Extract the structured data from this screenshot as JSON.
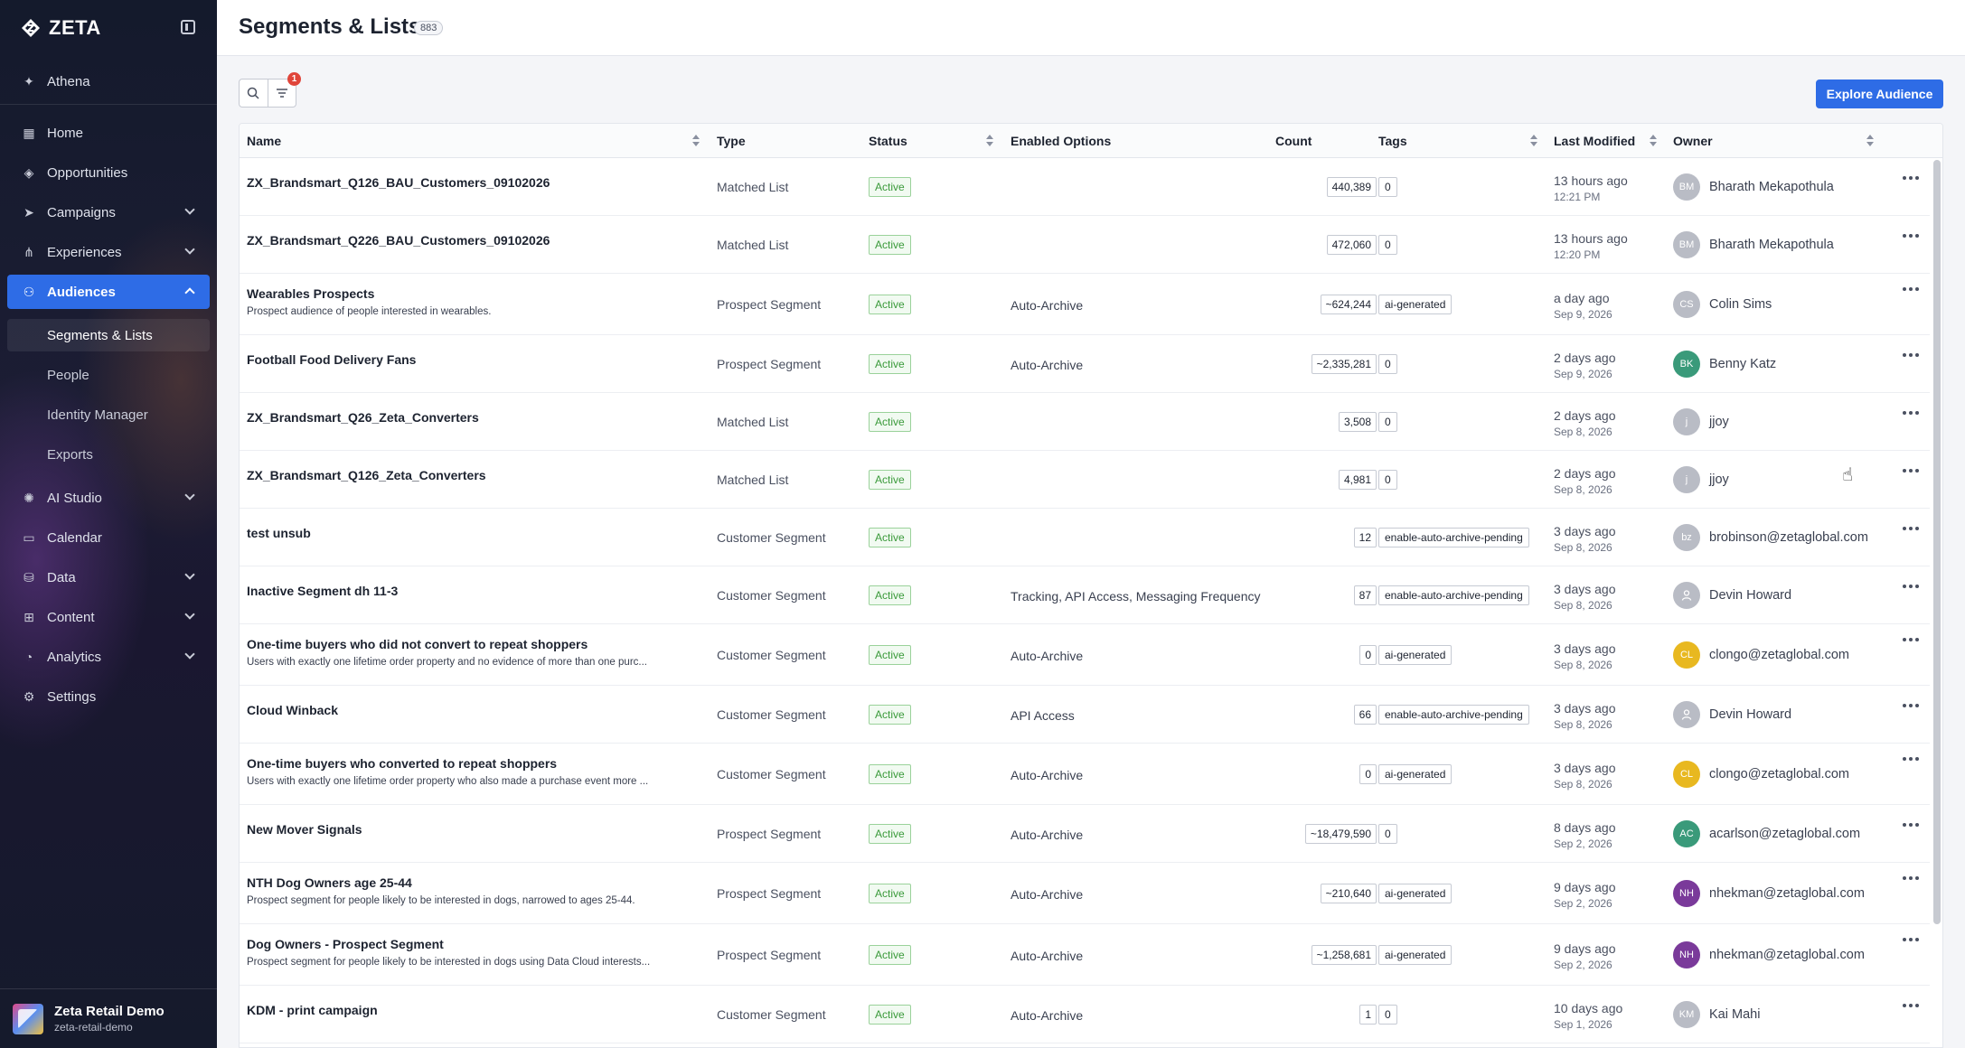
{
  "app": {
    "brand": "ZETA"
  },
  "sidebar": {
    "items": [
      {
        "label": "Athena",
        "icon": "sparkle-icon"
      },
      {
        "label": "Home",
        "icon": "grid-icon"
      },
      {
        "label": "Opportunities",
        "icon": "diamond-icon"
      },
      {
        "label": "Campaigns",
        "icon": "send-icon"
      },
      {
        "label": "Experiences",
        "icon": "hierarchy-icon"
      },
      {
        "label": "Audiences",
        "icon": "audience-icon"
      },
      {
        "label": "AI Studio",
        "icon": "brain-icon"
      },
      {
        "label": "Calendar",
        "icon": "calendar-icon"
      },
      {
        "label": "Data",
        "icon": "database-icon"
      },
      {
        "label": "Content",
        "icon": "content-icon"
      },
      {
        "label": "Analytics",
        "icon": "chart-icon"
      },
      {
        "label": "Settings",
        "icon": "gear-icon"
      }
    ],
    "sub_items": [
      "Segments & Lists",
      "People",
      "Identity Manager",
      "Exports"
    ],
    "account": {
      "name": "Zeta Retail Demo",
      "sub": "zeta-retail-demo"
    }
  },
  "header": {
    "title": "Segments & Lists",
    "count": "883"
  },
  "toolbar": {
    "filter_count": "1",
    "explore_label": "Explore Audience"
  },
  "table": {
    "columns": [
      "Name",
      "Type",
      "Status",
      "Enabled Options",
      "Count",
      "Tags",
      "Last Modified",
      "Owner"
    ],
    "rows": [
      {
        "name": "ZX_Brandsmart_Q126_BAU_Customers_09102026",
        "desc": "",
        "type": "Matched List",
        "status": "Active",
        "opts": "",
        "count": "440,389",
        "tag": "0",
        "mod": "13 hours ago",
        "date": "12:21 PM",
        "initials": "BM",
        "owner": "Bharath Mekapothula",
        "avatar_color": "#b9bcc5"
      },
      {
        "name": "ZX_Brandsmart_Q226_BAU_Customers_09102026",
        "desc": "",
        "type": "Matched List",
        "status": "Active",
        "opts": "",
        "count": "472,060",
        "tag": "0",
        "mod": "13 hours ago",
        "date": "12:20 PM",
        "initials": "BM",
        "owner": "Bharath Mekapothula",
        "avatar_color": "#b9bcc5"
      },
      {
        "name": "Wearables Prospects",
        "desc": "Prospect audience of people interested in wearables.",
        "type": "Prospect Segment",
        "status": "Active",
        "opts": "Auto-Archive",
        "count": "~624,244",
        "tag": "ai-generated",
        "mod": "a day ago",
        "date": "Sep 9, 2026",
        "initials": "CS",
        "owner": "Colin Sims",
        "avatar_color": "#b9bcc5"
      },
      {
        "name": "Football Food Delivery Fans",
        "desc": "",
        "type": "Prospect Segment",
        "status": "Active",
        "opts": "Auto-Archive",
        "count": "~2,335,281",
        "tag": "0",
        "mod": "2 days ago",
        "date": "Sep 9, 2026",
        "initials": "BK",
        "owner": "Benny Katz",
        "avatar_color": "#3a9a7a"
      },
      {
        "name": "ZX_Brandsmart_Q26_Zeta_Converters",
        "desc": "",
        "type": "Matched List",
        "status": "Active",
        "opts": "",
        "count": "3,508",
        "tag": "0",
        "mod": "2 days ago",
        "date": "Sep 8, 2026",
        "initials": "j",
        "owner": "jjoy",
        "avatar_color": "#b9bcc5"
      },
      {
        "name": "ZX_Brandsmart_Q126_Zeta_Converters",
        "desc": "",
        "type": "Matched List",
        "status": "Active",
        "opts": "",
        "count": "4,981",
        "tag": "0",
        "mod": "2 days ago",
        "date": "Sep 8, 2026",
        "initials": "j",
        "owner": "jjoy",
        "avatar_color": "#b9bcc5"
      },
      {
        "name": "test unsub",
        "desc": "",
        "type": "Customer Segment",
        "status": "Active",
        "opts": "",
        "count": "12",
        "tag": "enable-auto-archive-pending",
        "mod": "3 days ago",
        "date": "Sep 8, 2026",
        "initials": "bz",
        "owner": "brobinson@zetaglobal.com",
        "avatar_color": "#b9bcc5"
      },
      {
        "name": "Inactive Segment dh 11-3",
        "desc": "",
        "type": "Customer Segment",
        "status": "Active",
        "opts": "Tracking, API Access, Messaging Frequency",
        "count": "87",
        "tag": "enable-auto-archive-pending",
        "mod": "3 days ago",
        "date": "Sep 8, 2026",
        "initials": "",
        "owner": "Devin Howard",
        "avatar_color": "#b9bcc5"
      },
      {
        "name": "One-time buyers who did not convert to repeat shoppers",
        "desc": "Users with exactly one lifetime order property and no evidence of more than one purc...",
        "type": "Customer Segment",
        "status": "Active",
        "opts": "Auto-Archive",
        "count": "0",
        "tag": "ai-generated",
        "mod": "3 days ago",
        "date": "Sep 8, 2026",
        "initials": "CL",
        "owner": "clongo@zetaglobal.com",
        "avatar_color": "#e8b820"
      },
      {
        "name": "Cloud Winback",
        "desc": "",
        "type": "Customer Segment",
        "status": "Active",
        "opts": "API Access",
        "count": "66",
        "tag": "enable-auto-archive-pending",
        "mod": "3 days ago",
        "date": "Sep 8, 2026",
        "initials": "",
        "owner": "Devin Howard",
        "avatar_color": "#b9bcc5"
      },
      {
        "name": "One-time buyers who converted to repeat shoppers",
        "desc": "Users with exactly one lifetime order property who also made a purchase event more ...",
        "type": "Customer Segment",
        "status": "Active",
        "opts": "Auto-Archive",
        "count": "0",
        "tag": "ai-generated",
        "mod": "3 days ago",
        "date": "Sep 8, 2026",
        "initials": "CL",
        "owner": "clongo@zetaglobal.com",
        "avatar_color": "#e8b820"
      },
      {
        "name": "New Mover Signals",
        "desc": "",
        "type": "Prospect Segment",
        "status": "Active",
        "opts": "Auto-Archive",
        "count": "~18,479,590",
        "tag": "0",
        "mod": "8 days ago",
        "date": "Sep 2, 2026",
        "initials": "AC",
        "owner": "acarlson@zetaglobal.com",
        "avatar_color": "#3a9a7a"
      },
      {
        "name": "NTH Dog Owners age 25-44",
        "desc": "Prospect segment for people likely to be interested in dogs, narrowed to ages 25-44.",
        "type": "Prospect Segment",
        "status": "Active",
        "opts": "Auto-Archive",
        "count": "~210,640",
        "tag": "ai-generated",
        "mod": "9 days ago",
        "date": "Sep 2, 2026",
        "initials": "NH",
        "owner": "nhekman@zetaglobal.com",
        "avatar_color": "#7a3a9a"
      },
      {
        "name": "Dog Owners - Prospect Segment",
        "desc": "Prospect segment for people likely to be interested in dogs using Data Cloud interests...",
        "type": "Prospect Segment",
        "status": "Active",
        "opts": "Auto-Archive",
        "count": "~1,258,681",
        "tag": "ai-generated",
        "mod": "9 days ago",
        "date": "Sep 2, 2026",
        "initials": "NH",
        "owner": "nhekman@zetaglobal.com",
        "avatar_color": "#7a3a9a"
      },
      {
        "name": "KDM - print campaign",
        "desc": "",
        "type": "Customer Segment",
        "status": "Active",
        "opts": "Auto-Archive",
        "count": "1",
        "tag": "0",
        "mod": "10 days ago",
        "date": "Sep 1, 2026",
        "initials": "KM",
        "owner": "Kai Mahi",
        "avatar_color": "#b9bcc5"
      }
    ]
  }
}
